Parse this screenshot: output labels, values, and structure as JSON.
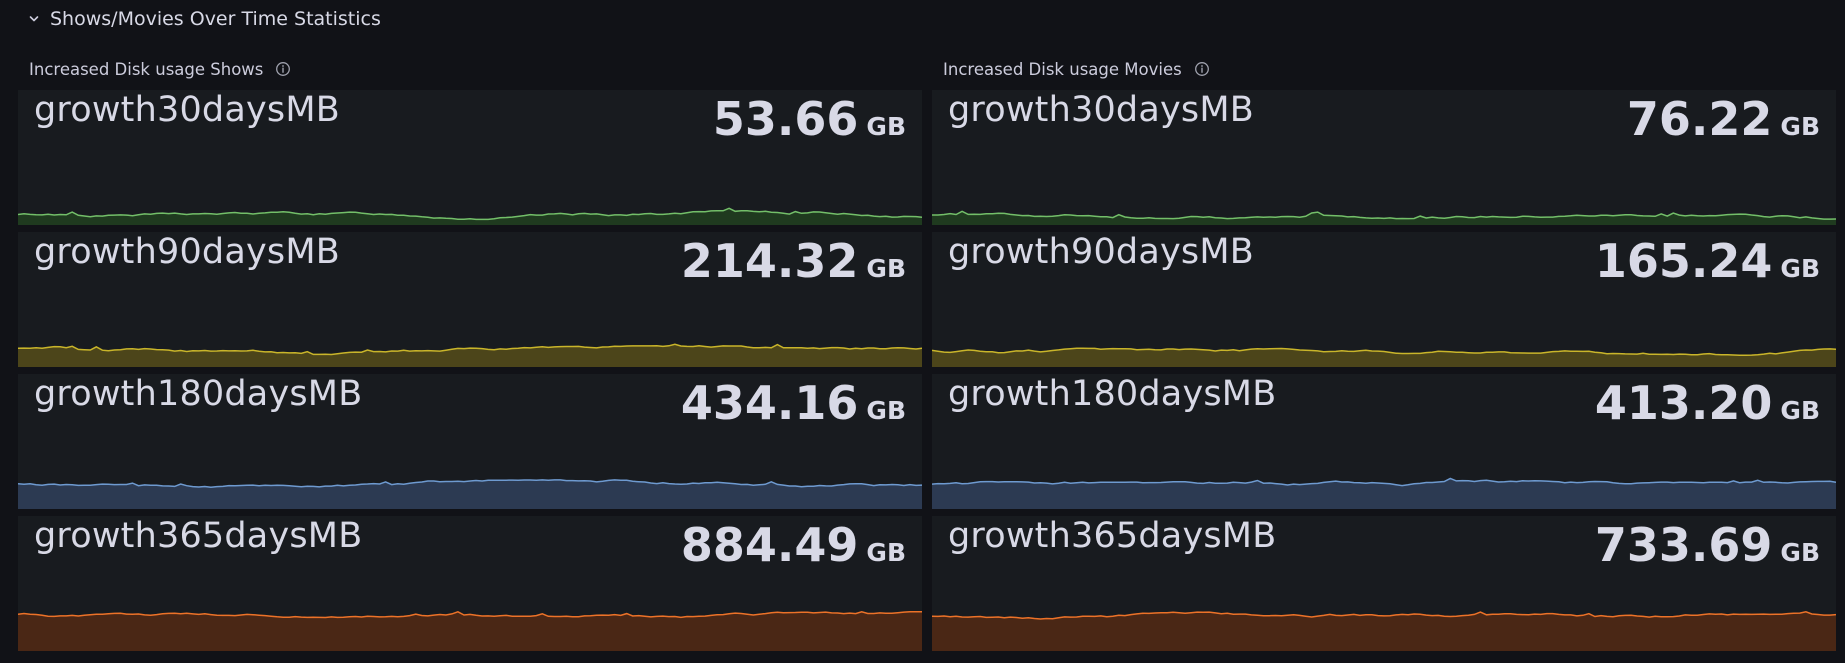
{
  "row": {
    "title": "Shows/Movies Over Time Statistics",
    "collapse_icon": "chevron-down-icon"
  },
  "panels": [
    {
      "title": "Increased Disk usage Shows",
      "info_icon": "info-circle-icon",
      "stats": [
        {
          "name": "growth30daysMB",
          "value": "53.66",
          "unit": "GB",
          "color": "#73bf69",
          "fill": "#1f3a1f",
          "level": 0.25
        },
        {
          "name": "growth90daysMB",
          "value": "214.32",
          "unit": "GB",
          "color": "#c9b52a",
          "fill": "#4c451a",
          "level": 0.42
        },
        {
          "name": "growth180daysMB",
          "value": "434.16",
          "unit": "GB",
          "color": "#6e9ad0",
          "fill": "#2c3a52",
          "level": 0.62
        },
        {
          "name": "growth365daysMB",
          "value": "884.49",
          "unit": "GB",
          "color": "#ec7228",
          "fill": "#4a2715",
          "level": 0.92
        }
      ]
    },
    {
      "title": "Increased Disk usage Movies",
      "info_icon": "info-circle-icon",
      "stats": [
        {
          "name": "growth30daysMB",
          "value": "76.22",
          "unit": "GB",
          "color": "#73bf69",
          "fill": "#1f3a1f",
          "level": 0.25
        },
        {
          "name": "growth90daysMB",
          "value": "165.24",
          "unit": "GB",
          "color": "#c9b52a",
          "fill": "#4c451a",
          "level": 0.4
        },
        {
          "name": "growth180daysMB",
          "value": "413.20",
          "unit": "GB",
          "color": "#6e9ad0",
          "fill": "#2c3a52",
          "level": 0.62
        },
        {
          "name": "growth365daysMB",
          "value": "733.69",
          "unit": "GB",
          "color": "#ec7228",
          "fill": "#4a2715",
          "level": 0.88
        }
      ]
    }
  ]
}
